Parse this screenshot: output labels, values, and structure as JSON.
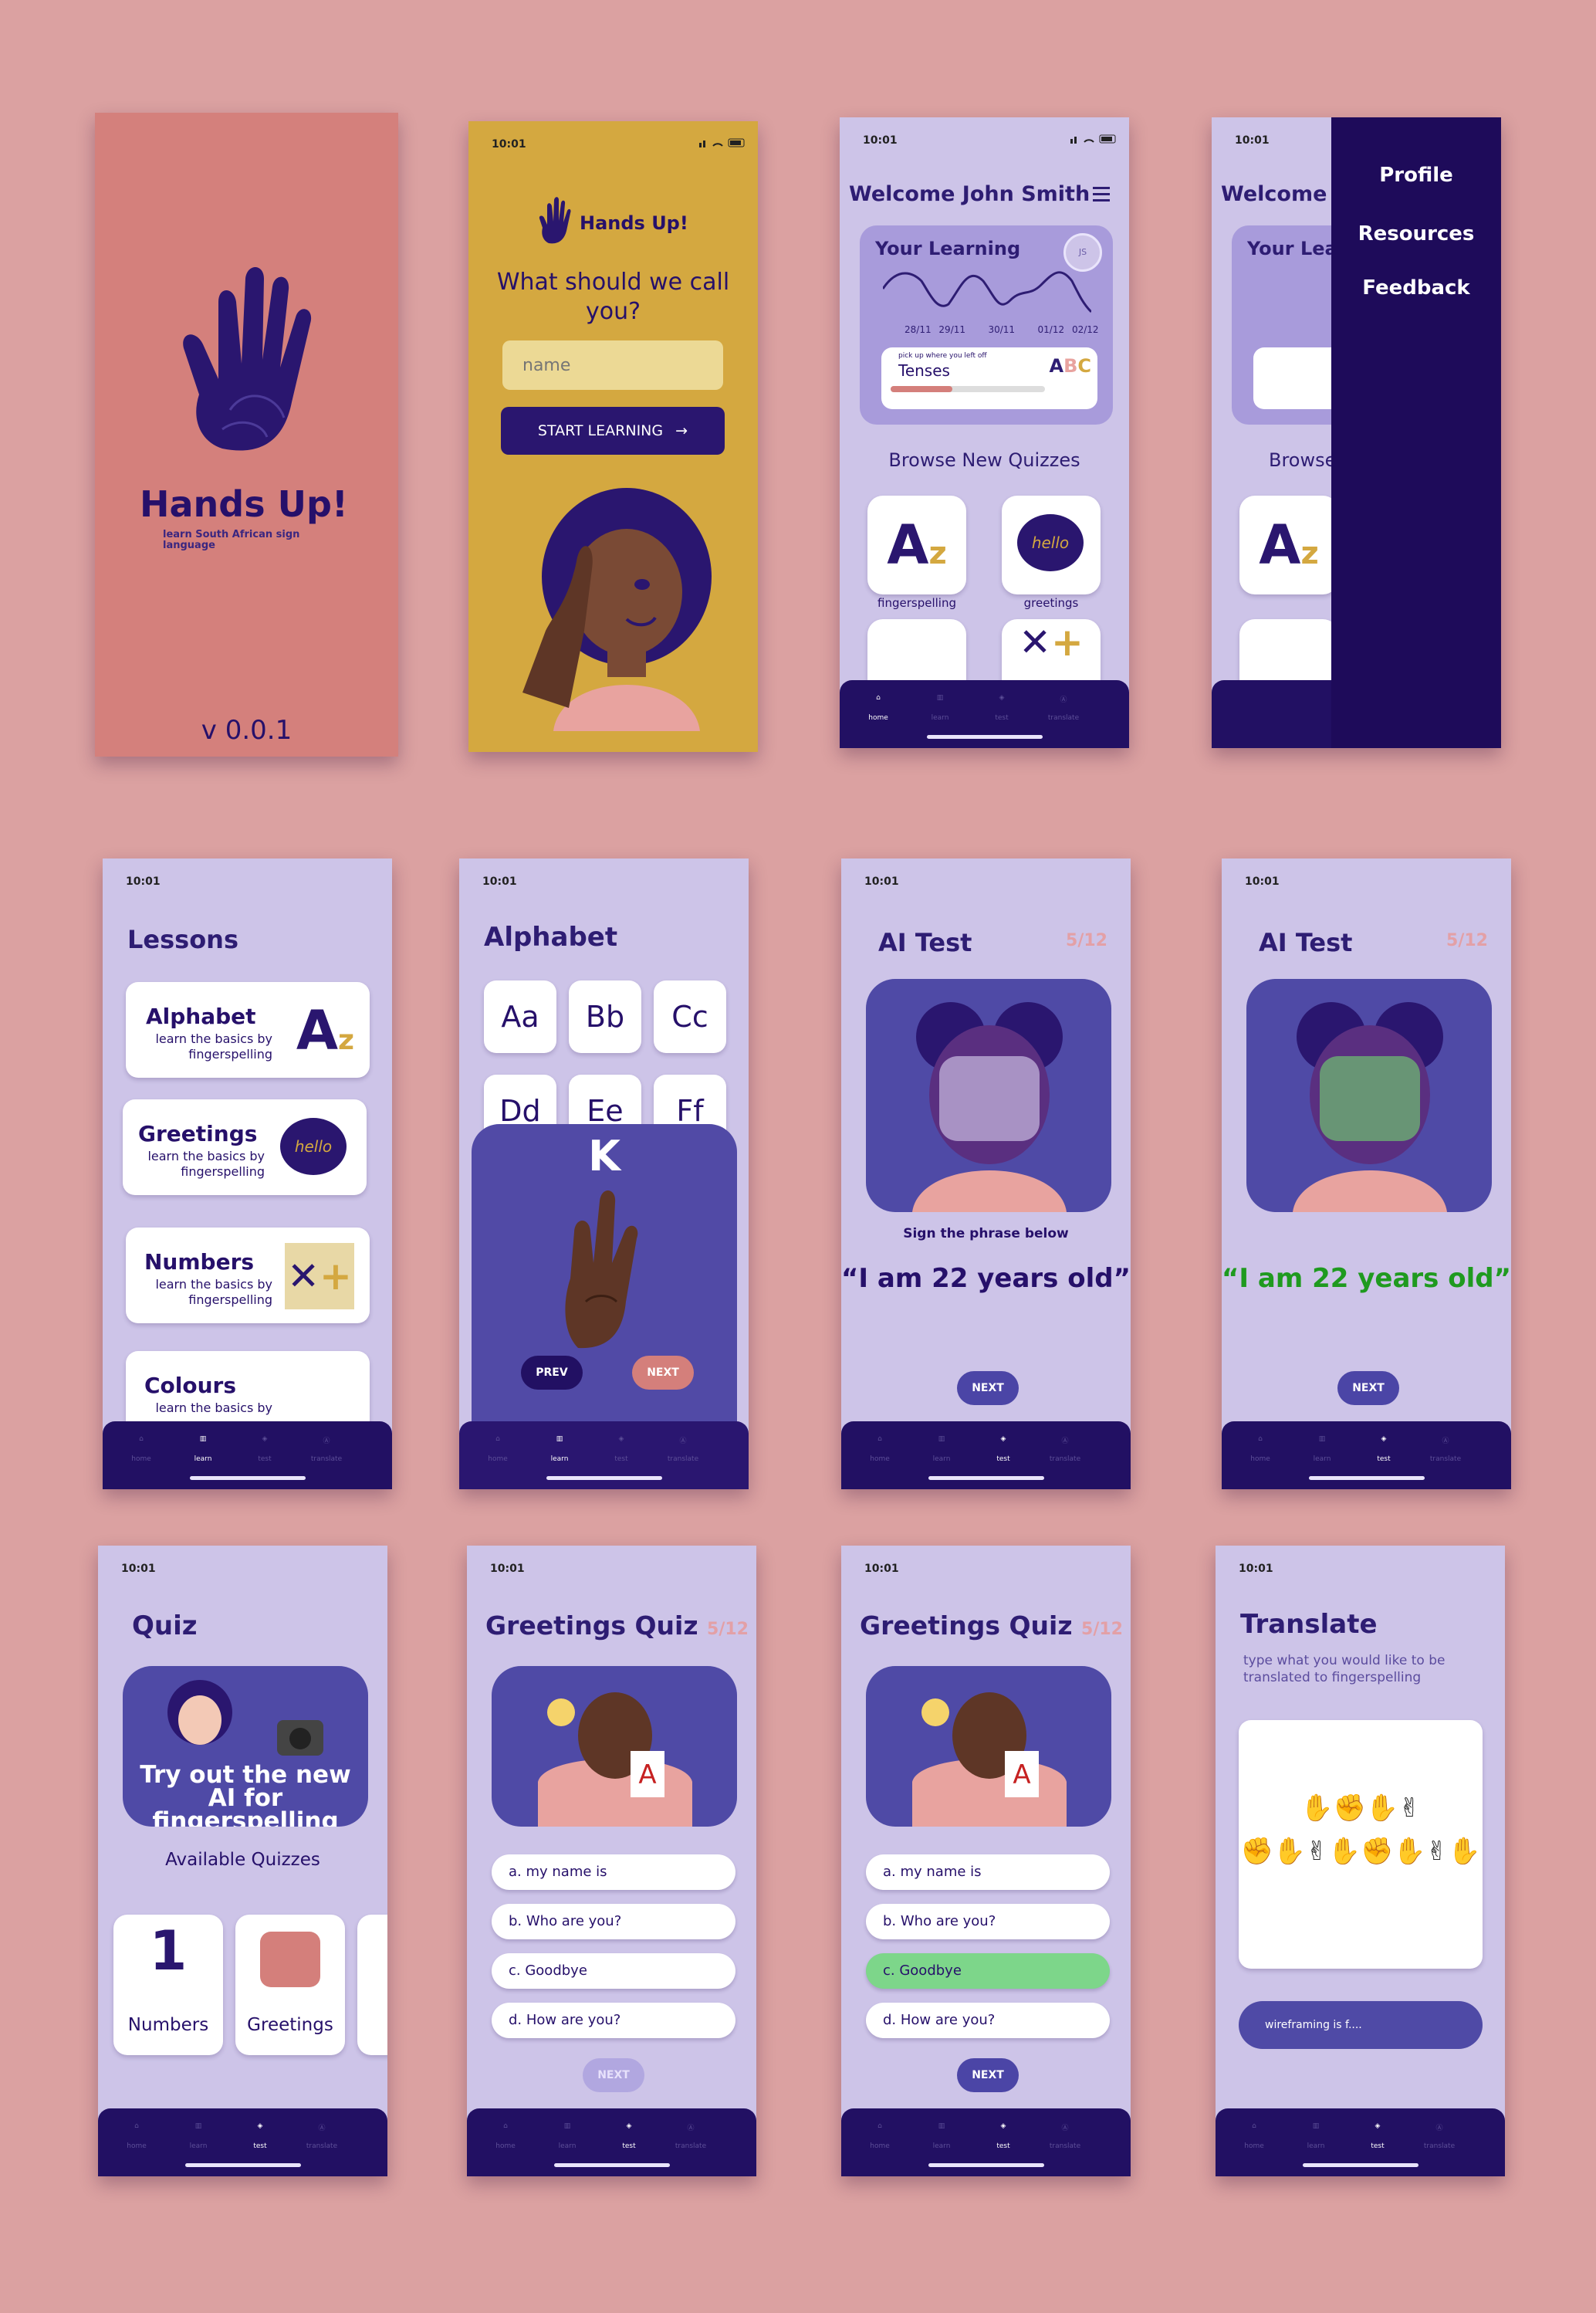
{
  "status_time": "10:01",
  "colors": {
    "bg": "#dba1a1",
    "lavender": "#cdc4e8",
    "navy": "#221063",
    "accent": "#d47f7b",
    "yellow": "#d4a840",
    "green": "#7dd68a"
  },
  "nav": [
    {
      "label": "home",
      "icon": "home-icon"
    },
    {
      "label": "learn",
      "icon": "book-icon"
    },
    {
      "label": "test",
      "icon": "graduation-cap-icon"
    },
    {
      "label": "translate",
      "icon": "translate-icon"
    }
  ],
  "splash": {
    "title": "Hands Up!",
    "subtitle": "learn South African sign language",
    "version": "v 0.0.1"
  },
  "onboarding": {
    "logo_text": "Hands Up!",
    "question": "What should we call you?",
    "placeholder": "name",
    "button": "START LEARNING"
  },
  "home": {
    "welcome": "Welcome John Smith",
    "your_learning": "Your Learning",
    "avatar": "JS",
    "dates": [
      "28/11",
      "29/11",
      "30/11",
      "01/12",
      "02/12"
    ],
    "resume_hint": "pick up where you left off",
    "resume_item": "Tenses",
    "progress": 0.4,
    "browse": "Browse New Quizzes",
    "quizzes": [
      "fingerspelling",
      "greetings"
    ]
  },
  "menu": {
    "welcome_partial": "Welcome J",
    "learn_partial": "Your Lear",
    "browse_partial": "Browse",
    "items": [
      "Profile",
      "Resources",
      "Feedback"
    ]
  },
  "lessons": {
    "title": "Lessons",
    "items": [
      {
        "title": "Alphabet",
        "desc": "learn the basics by fingerspelling"
      },
      {
        "title": "Greetings",
        "desc": "learn the basics by fingerspelling"
      },
      {
        "title": "Numbers",
        "desc": "learn the basics by fingerspelling"
      },
      {
        "title": "Colours",
        "desc": "learn the basics by"
      }
    ]
  },
  "alphabet": {
    "title": "Alphabet",
    "letters": [
      "Aa",
      "Bb",
      "Cc",
      "Dd",
      "Ee",
      "Ff"
    ],
    "current": "K",
    "prev": "PREV",
    "next": "NEXT"
  },
  "ai_test": {
    "title": "AI Test",
    "progress": "5/12",
    "instruction": "Sign the phrase below",
    "phrase": "“I am 22 years old”",
    "next": "NEXT"
  },
  "quiz": {
    "title": "Quiz",
    "banner": "Try out the new AI for fingerspelling",
    "available": "Available Quizzes",
    "cards": [
      "Numbers",
      "Greetings"
    ]
  },
  "greetings_quiz": {
    "title": "Greetings Quiz",
    "progress": "5/12",
    "options": [
      "a. my name is",
      "b. Who are you?",
      "c. Goodbye",
      "d. How are you?"
    ],
    "selected": "c. Goodbye",
    "next": "NEXT"
  },
  "translate": {
    "title": "Translate",
    "desc": "type what you would like to be translated to fingerspelling",
    "input": "wireframing is f...."
  }
}
